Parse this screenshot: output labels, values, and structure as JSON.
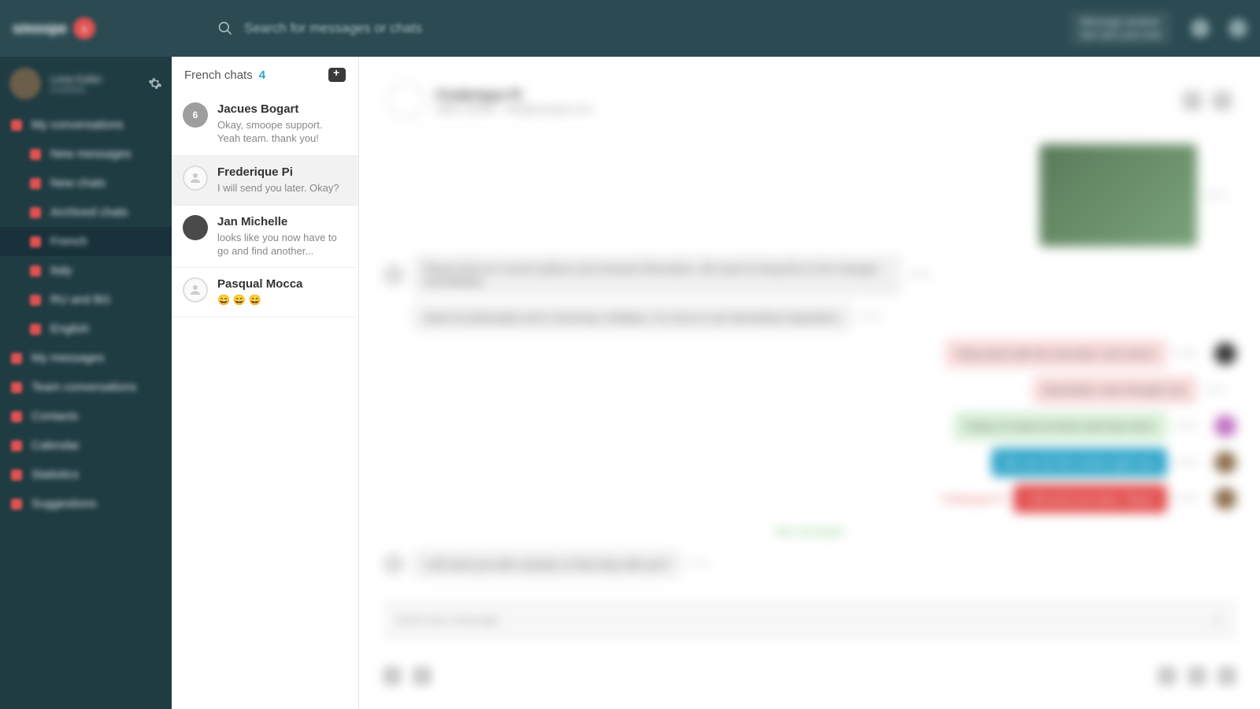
{
  "topbar": {
    "brand": "smoope",
    "search_placeholder": "Search for messages or chats",
    "status_line1": "Message window",
    "status_line2": "last sync just now"
  },
  "profile": {
    "name": "Lena Keller",
    "presence": "Available"
  },
  "nav": {
    "items": [
      {
        "label": "My conversations",
        "sub": false
      },
      {
        "label": "New messages",
        "sub": true
      },
      {
        "label": "New chats",
        "sub": true
      },
      {
        "label": "Archived chats",
        "sub": true
      },
      {
        "label": "French",
        "sub": true,
        "selected": true
      },
      {
        "label": "Italy",
        "sub": true
      },
      {
        "label": "RU and BG",
        "sub": true
      },
      {
        "label": "English",
        "sub": true
      },
      {
        "label": "My messages",
        "sub": false
      },
      {
        "label": "Team conversations",
        "sub": false
      },
      {
        "label": "Contacts",
        "sub": false
      },
      {
        "label": "Calendar",
        "sub": false
      },
      {
        "label": "Statistics",
        "sub": false
      },
      {
        "label": "Suggestions",
        "sub": false
      }
    ]
  },
  "chatlist": {
    "title": "French chats",
    "count": "4",
    "items": [
      {
        "name": "Jacues Bogart",
        "preview": "Okay, smoope support. Yeah team. thank you!",
        "badge": "6",
        "avatar": "num"
      },
      {
        "name": "Frederique Pi",
        "preview": "I will send you later. Okay?",
        "avatar": "light",
        "selected": true
      },
      {
        "name": "Jan Michelle",
        "preview": "looks like you now have to go and find another...",
        "avatar": "user"
      },
      {
        "name": "Pasqual Mocca",
        "preview": "😄 😄 😄",
        "avatar": "light"
      }
    ]
  },
  "conversation": {
    "contact_name": "Frederique Pi",
    "contact_phone": "0800 123456",
    "contact_email": "info@example.com",
    "composer_placeholder": "Send new message",
    "new_messages_label": "New messages",
    "red_label": "Frederique Pi:"
  }
}
